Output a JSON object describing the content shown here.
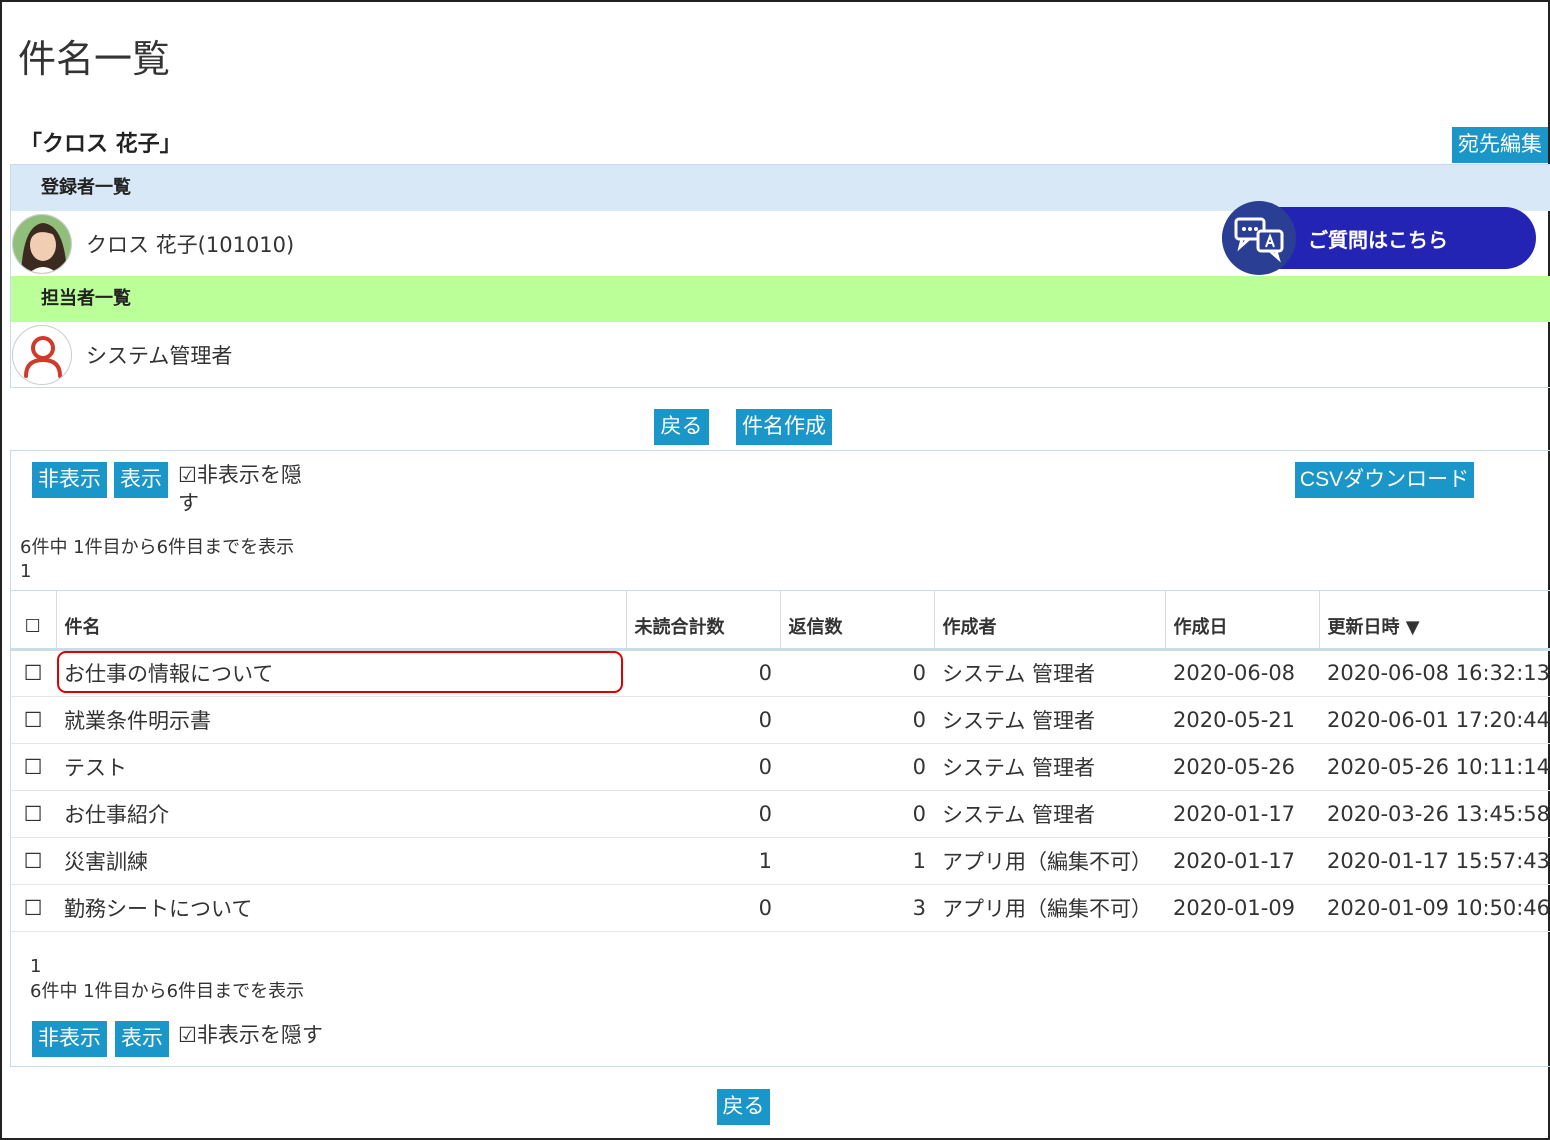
{
  "page": {
    "title": "件名一覧"
  },
  "group": {
    "title": "「クロス 花子」",
    "edit_dest_label": "宛先編集"
  },
  "registrants": {
    "header": "登録者一覧",
    "members": [
      {
        "name": "クロス 花子(101010)"
      }
    ]
  },
  "staff": {
    "header": "担当者一覧",
    "members": [
      {
        "name": "システム管理者"
      }
    ]
  },
  "help_button": {
    "label": "ご質問はこちら"
  },
  "actions": {
    "back_label": "戻る",
    "create_label": "件名作成"
  },
  "list_controls": {
    "hide_label": "非表示",
    "show_label": "表示",
    "hide_hidden_label": "☑非表示を隠す",
    "csv_label": "CSVダウンロード",
    "count_text": "6件中 1件目から6件目までを表示",
    "page_number": "1"
  },
  "table": {
    "select_all": "☐",
    "columns": [
      "件名",
      "未読合計数",
      "返信数",
      "作成者",
      "作成日",
      "更新日時 ▼"
    ],
    "rows": [
      {
        "check": "☐",
        "subject": "お仕事の情報について",
        "unread": "0",
        "replies": "0",
        "creator": "システム 管理者",
        "created": "2020-06-08",
        "updated": "2020-06-08 16:32:13"
      },
      {
        "check": "☐",
        "subject": "就業条件明示書",
        "unread": "0",
        "replies": "0",
        "creator": "システム 管理者",
        "created": "2020-05-21",
        "updated": "2020-06-01 17:20:44"
      },
      {
        "check": "☐",
        "subject": "テスト",
        "unread": "0",
        "replies": "0",
        "creator": "システム 管理者",
        "created": "2020-05-26",
        "updated": "2020-05-26 10:11:14"
      },
      {
        "check": "☐",
        "subject": "お仕事紹介",
        "unread": "0",
        "replies": "0",
        "creator": "システム 管理者",
        "created": "2020-01-17",
        "updated": "2020-03-26 13:45:58"
      },
      {
        "check": "☐",
        "subject": "災害訓練",
        "unread": "1",
        "replies": "1",
        "creator": "アプリ用（編集不可）",
        "created": "2020-01-17",
        "updated": "2020-01-17 15:57:43"
      },
      {
        "check": "☐",
        "subject": "勤務シートについて",
        "unread": "0",
        "replies": "3",
        "creator": "アプリ用（編集不可）",
        "created": "2020-01-09",
        "updated": "2020-01-09 10:50:46"
      }
    ]
  },
  "colors": {
    "button_bg": "#1a96c8",
    "registrant_header_bg": "#d8e8f6",
    "staff_header_bg": "#bbff99",
    "help_button_bg": "#2424b4",
    "highlight_border": "#e00000"
  }
}
